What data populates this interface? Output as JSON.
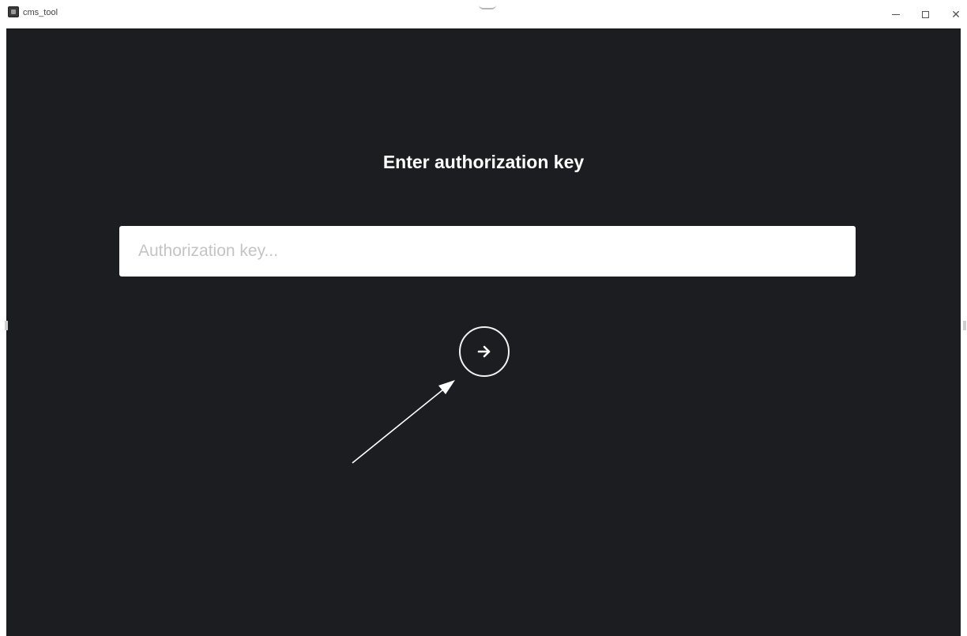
{
  "window": {
    "title": "cms_tool",
    "controls": {
      "minimize": "minimize",
      "maximize": "maximize",
      "close": "✕"
    }
  },
  "auth": {
    "heading": "Enter authorization key",
    "input_placeholder": "Authorization key...",
    "input_value": "",
    "submit_icon": "arrow-right-icon"
  },
  "annotation": {
    "icon": "pointer-arrow-icon",
    "color": "#ffffff"
  },
  "colors": {
    "background": "#1b1d20",
    "heading": "#ffffff",
    "input_background": "#ffffff",
    "placeholder": "#c4c4c4",
    "button_outline": "#f2f2f2"
  }
}
